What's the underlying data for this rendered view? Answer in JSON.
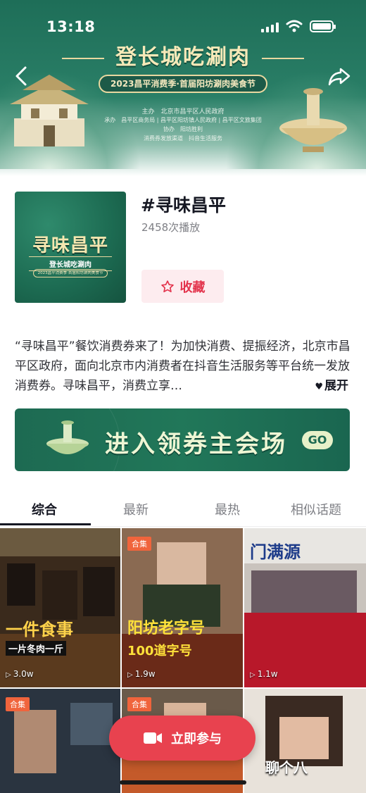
{
  "status_bar": {
    "time": "13:18"
  },
  "banner": {
    "title": "登长城吃涮肉",
    "subtitle": "2023昌平消费季·首届阳坊涮肉美食节",
    "org_host": "主办　北京市昌平区人民政府",
    "org_undertake": "承办　昌平区商务局 | 昌平区阳坊镇人民政府 | 昌平区文旅集团",
    "org_assist": "协办　阳坊胜利",
    "org_platform": "消费券发放渠道　抖音生活服务"
  },
  "topic": {
    "cover_main": "寻味昌平",
    "cover_sub": "登长城吃涮肉",
    "cover_sub2": "2023昌平消费季·首届阳坊涮肉美食节",
    "title": "#寻味昌平",
    "plays": "2458次播放",
    "favorite_label": "收藏",
    "description": "“寻味昌平”餐饮消费券来了！为加快消费、提振经济，北京市昌平区政府，面向北京市内消费者在抖音生活服务等平台统一发放消费券。寻味昌平，消费立享…",
    "expand_label": "展开"
  },
  "promo": {
    "label": "进入领券主会场",
    "go_label": "GO"
  },
  "tabs": [
    {
      "label": "综合",
      "active": true
    },
    {
      "label": "最新",
      "active": false
    },
    {
      "label": "最热",
      "active": false
    },
    {
      "label": "相似话题",
      "active": false
    }
  ],
  "videos": [
    {
      "caption": "一件食事",
      "subcaption": "一片冬肉一斤",
      "stat": "3.0w"
    },
    {
      "tag": "合集",
      "caption": "阳坊老字号",
      "subcaption": "100道字号",
      "stat": "1.9w"
    },
    {
      "caption": "门满源",
      "stat": "1.1w"
    },
    {
      "tag": "合集"
    },
    {
      "tag": "合集"
    },
    {
      "caption": "聊个八"
    }
  ],
  "join_button": {
    "label": "立即参与"
  },
  "colors": {
    "accent": "#e8424f",
    "brand_green": "#1d6a52",
    "text_primary": "#161823",
    "text_secondary": "#7f8086"
  },
  "icons": [
    "back-arrow-icon",
    "share-icon",
    "star-icon",
    "heart-icon",
    "play-icon",
    "camera-icon"
  ]
}
